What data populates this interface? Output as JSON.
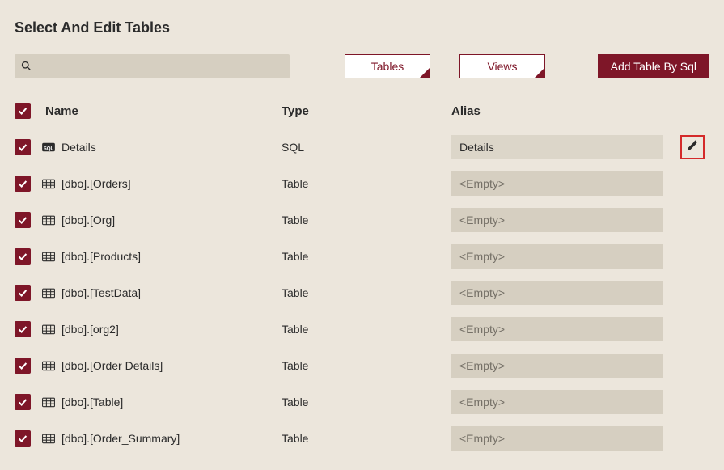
{
  "page_title": "Select And Edit Tables",
  "search": {
    "placeholder": ""
  },
  "buttons": {
    "tables": "Tables",
    "views": "Views",
    "add_sql": "Add Table By Sql"
  },
  "columns": {
    "name": "Name",
    "type": "Type",
    "alias": "Alias"
  },
  "alias_placeholder": "<Empty>",
  "rows": [
    {
      "icon": "sql",
      "name": "Details",
      "type": "SQL",
      "alias": "Details",
      "editing": true
    },
    {
      "icon": "table",
      "name": "[dbo].[Orders]",
      "type": "Table",
      "alias": ""
    },
    {
      "icon": "table",
      "name": "[dbo].[Org]",
      "type": "Table",
      "alias": ""
    },
    {
      "icon": "table",
      "name": "[dbo].[Products]",
      "type": "Table",
      "alias": ""
    },
    {
      "icon": "table",
      "name": "[dbo].[TestData]",
      "type": "Table",
      "alias": ""
    },
    {
      "icon": "table",
      "name": "[dbo].[org2]",
      "type": "Table",
      "alias": ""
    },
    {
      "icon": "table",
      "name": "[dbo].[Order Details]",
      "type": "Table",
      "alias": ""
    },
    {
      "icon": "table",
      "name": "[dbo].[Table]",
      "type": "Table",
      "alias": ""
    },
    {
      "icon": "table",
      "name": "[dbo].[Order_Summary]",
      "type": "Table",
      "alias": ""
    }
  ]
}
